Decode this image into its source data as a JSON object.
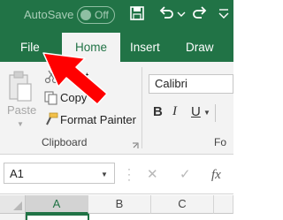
{
  "titlebar": {
    "autosave_label": "AutoSave",
    "toggle_state": "Off",
    "icons": [
      "save-icon",
      "undo-icon",
      "undo-dropdown-icon",
      "redo-icon",
      "customize-quick-access-icon"
    ]
  },
  "tabs": {
    "file": "File",
    "home": "Home",
    "insert": "Insert",
    "draw": "Draw"
  },
  "clipboard": {
    "paste_label": "Paste",
    "cut_label": "Cut",
    "copy_label": "Copy",
    "format_painter_label": "Format Painter",
    "group_label": "Clipboard"
  },
  "font": {
    "font_name": "Calibri",
    "bold": "B",
    "italic": "I",
    "underline": "U",
    "group_label": "Fo"
  },
  "formula_bar": {
    "name_box_value": "A1",
    "cancel_symbol": "✕",
    "enter_symbol": "✓"
  },
  "grid": {
    "columns": [
      "A",
      "B",
      "C"
    ],
    "selected_cell": "A1"
  },
  "colors": {
    "excel_green": "#217346",
    "callout_arrow": "#ff0000"
  }
}
